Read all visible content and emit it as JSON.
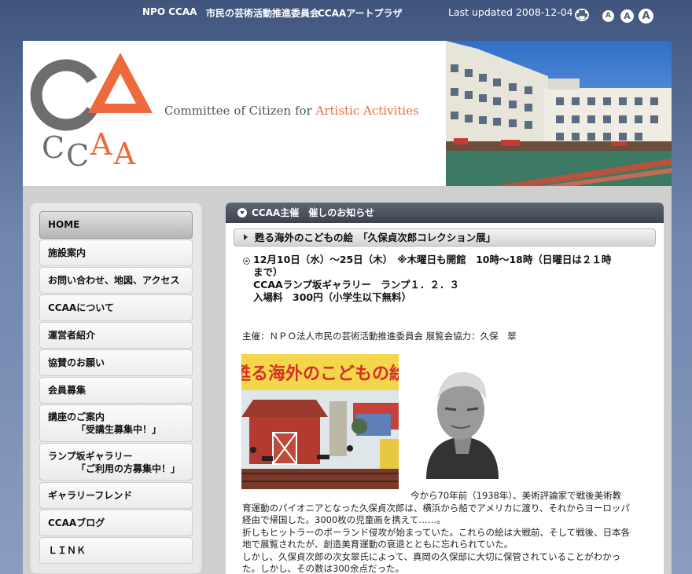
{
  "topbar": {
    "links": [
      "NPO CCAA",
      "市民の芸術活動推進委員会",
      "CCAAアートプラザ"
    ],
    "last_updated": "Last updated 2008-12-04",
    "font_sizes": [
      "A",
      "A",
      "A"
    ]
  },
  "header": {
    "tagline_main": "Committee of Citizen for ",
    "tagline_accent": "Artistic Activities",
    "logo_letters": {
      "c1": "C",
      "c2": "C",
      "a1": "A",
      "a2": "A"
    },
    "accent_color": "#ee6a3c"
  },
  "sidebar": {
    "items": [
      {
        "label": "HOME"
      },
      {
        "label": "施設案内"
      },
      {
        "label": "お問い合わせ、地図、アクセス"
      },
      {
        "label": "CCAAについて"
      },
      {
        "label": "運営者紹介"
      },
      {
        "label": "協賛のお願い"
      },
      {
        "label": "会員募集"
      },
      {
        "label": "講座のご案内",
        "sub": "「受講生募集中！」"
      },
      {
        "label": "ランプ坂ギャラリー",
        "sub": "「ご利用の方募集中！」"
      },
      {
        "label": "ギャラリーフレンド"
      },
      {
        "label": "CCAAブログ"
      },
      {
        "label": "ＬＩＮＫ"
      }
    ]
  },
  "content": {
    "section_title": "CCAA主催　催しのお知らせ",
    "event_title": "甦る海外のこどもの絵　「久保貞次郎コレクション展」",
    "event_lines": [
      "12月10日（水）～25日（木）　※木曜日も開館　10時～18時（日曜日は２１時",
      "まで）",
      "CCAAランプ坂ギャラリー　ランプ１．２．３",
      "入場料　300円（小学生以下無料）"
    ],
    "organizer": "主催：ＮＰＯ法人市民の芸術活動推進委員会 展覧会協力：久保　翠",
    "poster_title": "甦る海外のこどもの絵",
    "body_lines": [
      "今から70年前（1938年）、美術評論家で戦後美術教",
      "育運動のパイオニアとなった久保貞次郎は、横浜から船でアメリカに渡り、それからヨーロッパ",
      "経由で帰国した。3000枚の児童画を携えて……。",
      "折しもヒットラーのポーランド侵攻が始まっていた。これらの絵は大戦前、そして戦後、日本各",
      "地で展覧されたが、創造美育運動の衰退とともに忘れられていた。",
      "しかし、久保貞次郎の次女翠氏によって、真岡の久保邸に大切に保管されていることがわかっ",
      "た。しかし、その数は300余点だった。"
    ]
  }
}
